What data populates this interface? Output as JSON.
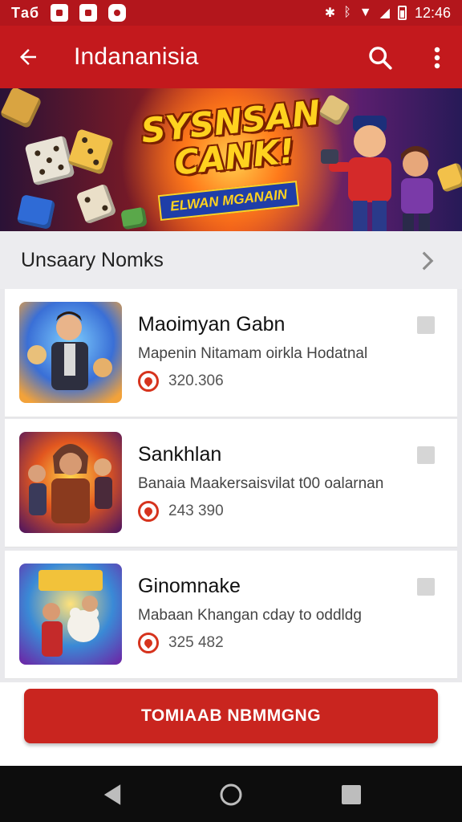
{
  "status_bar": {
    "carrier": "Tаб",
    "time": "12:46"
  },
  "app_bar": {
    "title": "Indananisia"
  },
  "banner": {
    "title_line1": "SYSNSAN",
    "title_line2": "CANK!",
    "subtitle": "ELWAN MGANAIN"
  },
  "section": {
    "title": "Unsaary Nomks"
  },
  "games": [
    {
      "name": "Maoimyan Gabn",
      "description": "Mapenin Nitamam oirkla Hodatnal",
      "stat": "320.306"
    },
    {
      "name": "Sankhlan",
      "description": "Banaia Maakersaisvilat t00 oalarnan",
      "stat": "243 390"
    },
    {
      "name": "Ginomnake",
      "description": "Mabaan Khangan cday to oddldg",
      "stat": "325 482"
    }
  ],
  "cta": {
    "label": "TOMIAAB NBMMGNG"
  },
  "icons": {
    "back": "arrow-back-icon",
    "search": "search-icon",
    "more": "more-vert-icon",
    "chevron": "chevron-right-icon",
    "stat": "heart-stat-icon",
    "nav_back": "nav-back-icon",
    "nav_home": "nav-home-icon",
    "nav_recents": "nav-recents-icon"
  },
  "colors": {
    "primary": "#c3191d",
    "status": "#b3161c",
    "accent": "#d6331d",
    "cta": "#c9251f"
  }
}
